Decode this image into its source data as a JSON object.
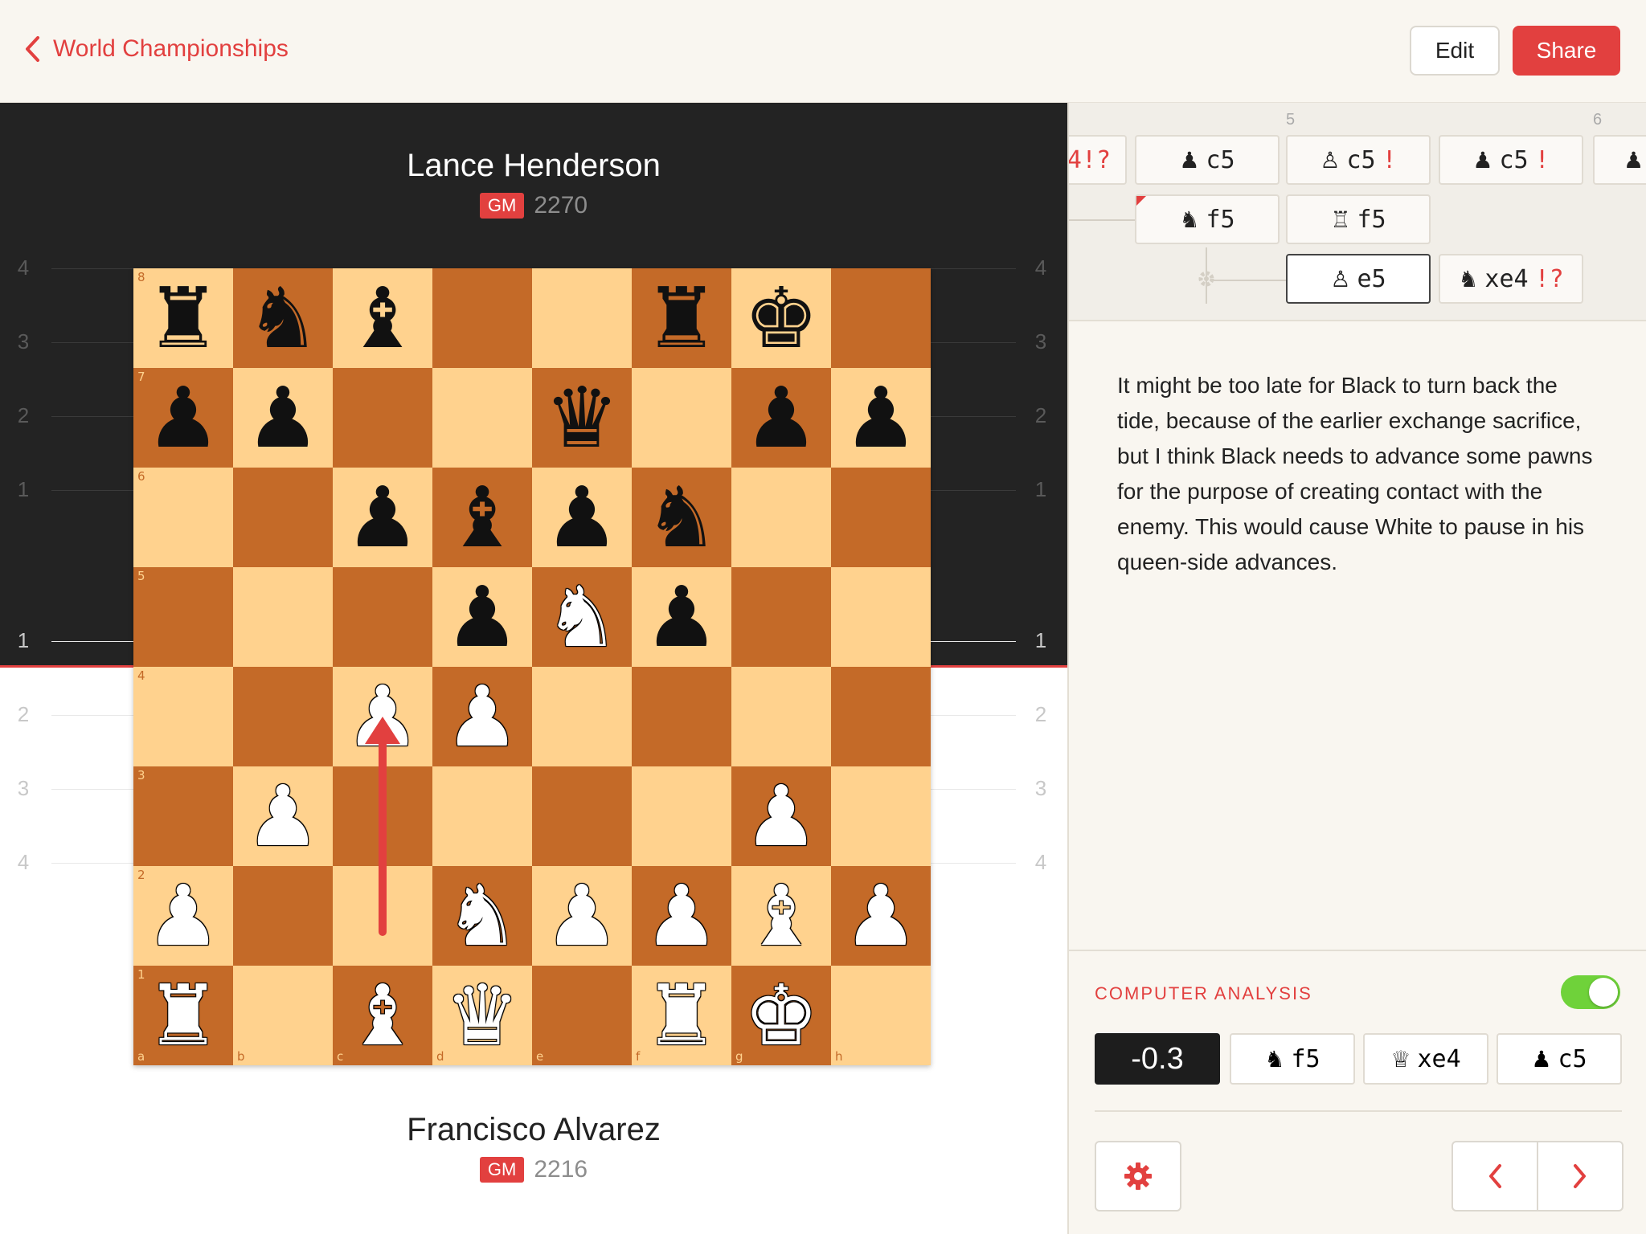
{
  "header": {
    "back_label": "World Championships",
    "edit_label": "Edit",
    "share_label": "Share"
  },
  "players": {
    "top": {
      "name": "Lance Henderson",
      "title": "GM",
      "rating": "2270"
    },
    "bottom": {
      "name": "Francisco Alvarez",
      "title": "GM",
      "rating": "2216"
    }
  },
  "eval_graph": {
    "top_ticks": [
      "4",
      "3",
      "2",
      "1"
    ],
    "bottom_ticks": [
      "1",
      "2",
      "3",
      "4"
    ]
  },
  "board": {
    "ranks": [
      "8",
      "7",
      "6",
      "5",
      "4",
      "3",
      "2",
      "1"
    ],
    "files": [
      "a",
      "b",
      "c",
      "d",
      "e",
      "f",
      "g",
      "h"
    ],
    "position": [
      [
        "r",
        "n",
        "b",
        "",
        "",
        "r",
        "k",
        ""
      ],
      [
        "p",
        "p",
        "",
        "",
        "q",
        "",
        "p",
        "p"
      ],
      [
        "",
        "",
        "p",
        "b",
        "p",
        "n",
        "",
        ""
      ],
      [
        "",
        "",
        "",
        "p",
        "N",
        "p",
        "",
        ""
      ],
      [
        "",
        "",
        "P",
        "P",
        "",
        "",
        "",
        ""
      ],
      [
        "",
        "P",
        "",
        "",
        "",
        "",
        "P",
        ""
      ],
      [
        "P",
        "",
        "",
        "N",
        "P",
        "P",
        "B",
        "P"
      ],
      [
        "R",
        "",
        "B",
        "Q",
        "",
        "R",
        "K",
        ""
      ]
    ],
    "arrow": {
      "from": "c2",
      "to": "c4"
    }
  },
  "move_tree": {
    "column_numbers": [
      "5",
      "6"
    ],
    "rows": [
      [
        {
          "piece": "",
          "text": "",
          "annotation": "4!?"
        },
        {
          "piece": "pawn-black",
          "text": "c5",
          "annotation": ""
        },
        {
          "piece": "pawn-white",
          "text": "c5",
          "annotation": "!"
        },
        {
          "piece": "pawn-black",
          "text": "c5",
          "annotation": "!"
        }
      ],
      [
        {
          "piece": "knight-black",
          "text": "f5",
          "annotation": ""
        },
        {
          "piece": "rook-white",
          "text": "f5",
          "annotation": ""
        }
      ],
      [
        {
          "piece": "pawn-white",
          "text": "e5",
          "annotation": ""
        },
        {
          "piece": "knight-black",
          "text": "xe4",
          "annotation": "!?"
        }
      ]
    ]
  },
  "comment": "It might be too late for Black to turn back the tide, because of the earlier exchange sacrifice, but I think Black needs to advance some pawns for the purpose of creating contact with the enemy. This would cause White to pause in his queen-side advances.",
  "analysis": {
    "title": "COMPUTER ANALYSIS",
    "enabled": true,
    "eval": "-0.3",
    "best_line": [
      {
        "piece": "knight-black",
        "text": "f5"
      },
      {
        "piece": "queen-white",
        "text": "xe4"
      },
      {
        "piece": "pawn-black",
        "text": "c5"
      }
    ]
  },
  "colors": {
    "accent": "#e2403f",
    "board_light": "#ffd28e",
    "board_dark": "#c46a28",
    "toggle_on": "#6fd23a"
  }
}
